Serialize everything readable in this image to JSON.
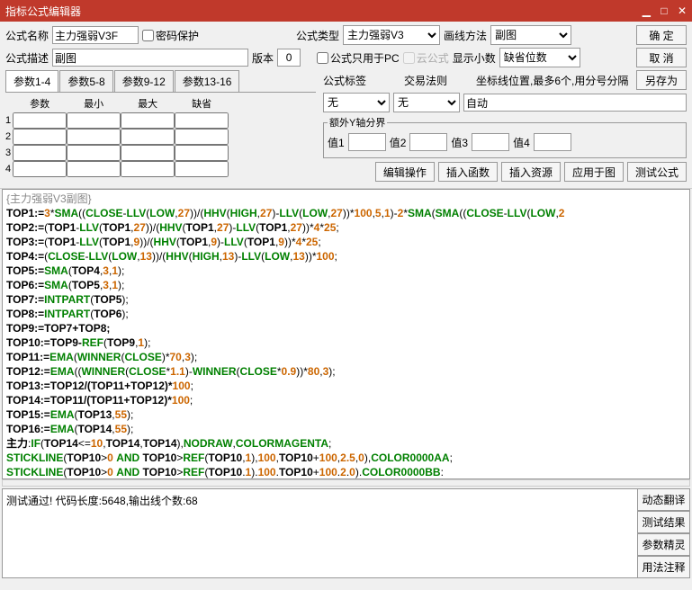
{
  "title": "指标公式编辑器",
  "labels": {
    "formulaName": "公式名称",
    "pwdProtect": "密码保护",
    "formulaType": "公式类型",
    "drawMethod": "画线方法",
    "formulaDesc": "公式描述",
    "version": "版本",
    "pcOnly": "公式只用于PC",
    "cloud": "云公式",
    "showDecimal": "显示小数",
    "formulaTag": "公式标签",
    "tradeRule": "交易法则",
    "axisPos": "坐标线位置,最多6个,用分号分隔",
    "extraY": "额外Y轴分界",
    "val1": "值1",
    "val2": "值2",
    "val3": "值3",
    "val4": "值4"
  },
  "values": {
    "formulaName": "主力强弱V3F",
    "formulaType": "主力强弱V3",
    "drawMethod": "副图",
    "formulaDesc": "副图",
    "version": "0",
    "showDecimal": "缺省位数",
    "formulaTag": "无",
    "tradeRule": "无",
    "axisPos": "自动"
  },
  "buttons": {
    "ok": "确 定",
    "cancel": "取 消",
    "saveAs": "另存为",
    "editOp": "编辑操作",
    "insertFn": "插入函数",
    "insertRes": "插入资源",
    "applyChart": "应用于图",
    "testFormula": "测试公式",
    "dynTrans": "动态翻译",
    "testResult": "测试结果",
    "paramWiz": "参数精灵",
    "usage": "用法注释"
  },
  "paramTabs": [
    "参数1-4",
    "参数5-8",
    "参数9-12",
    "参数13-16"
  ],
  "paramHdrs": [
    "参数",
    "最小",
    "最大",
    "缺省"
  ],
  "codeHeader": "{主力强弱V3副图}",
  "resultMsg": "测试通过! 代码长度:5648,输出线个数:68"
}
